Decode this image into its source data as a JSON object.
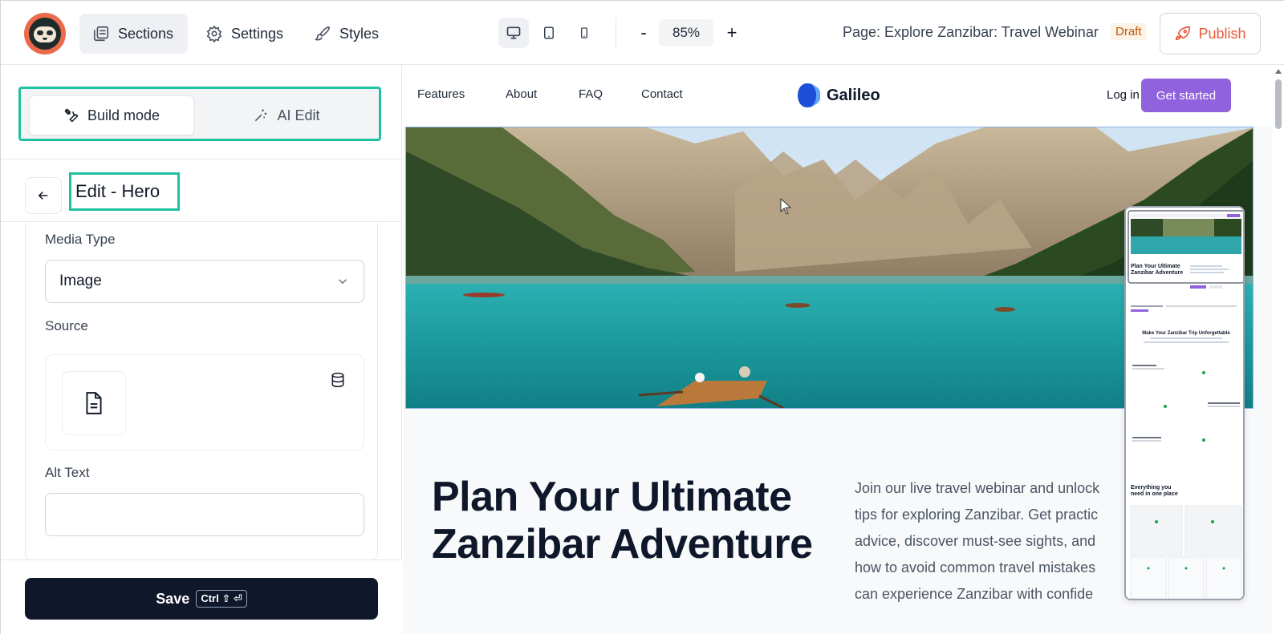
{
  "topbar": {
    "tabs": [
      {
        "label": "Sections",
        "icon": "sections-icon"
      },
      {
        "label": "Settings",
        "icon": "gear-icon"
      },
      {
        "label": "Styles",
        "icon": "brush-icon"
      }
    ],
    "zoom": {
      "minus": "-",
      "value": "85%",
      "plus": "+"
    },
    "page_title": "Page: Explore Zanzibar: Travel Webinar",
    "status_badge": "Draft",
    "publish_label": "Publish"
  },
  "left_panel": {
    "modes": {
      "build": "Build mode",
      "ai": "AI Edit"
    },
    "edit_title": "Edit - Hero",
    "form": {
      "media_type_label": "Media Type",
      "media_type_value": "Image",
      "source_label": "Source",
      "alt_text_label": "Alt Text",
      "alt_text_value": ""
    },
    "save": {
      "label": "Save",
      "shortcut": "Ctrl ⇧ ⏎"
    }
  },
  "preview": {
    "nav_links": [
      "Features",
      "About",
      "FAQ",
      "Contact"
    ],
    "brand": "Galileo",
    "login": "Log in",
    "cta": "Get started",
    "hero_title_line1": "Plan Your Ultimate",
    "hero_title_line2": "Zanzibar Adventure",
    "hero_desc_lines": [
      "Join our live travel webinar and unlock",
      "tips for exploring Zanzibar. Get practic",
      "advice, discover must-see sights, and",
      "how to avoid common travel mistakes",
      "can experience Zanzibar with confide"
    ],
    "minimap": {
      "hero_title": "Plan Your Ultimate Zanzibar Adventure",
      "section_title": "Make Your Zanzibar Trip Unforgettable",
      "features_title": "Everything you need in one place"
    }
  },
  "colors": {
    "accent_highlight": "#1fc2a0",
    "publish": "#ea5a3c",
    "cta": "#9062dd",
    "save": "#0f172a"
  }
}
